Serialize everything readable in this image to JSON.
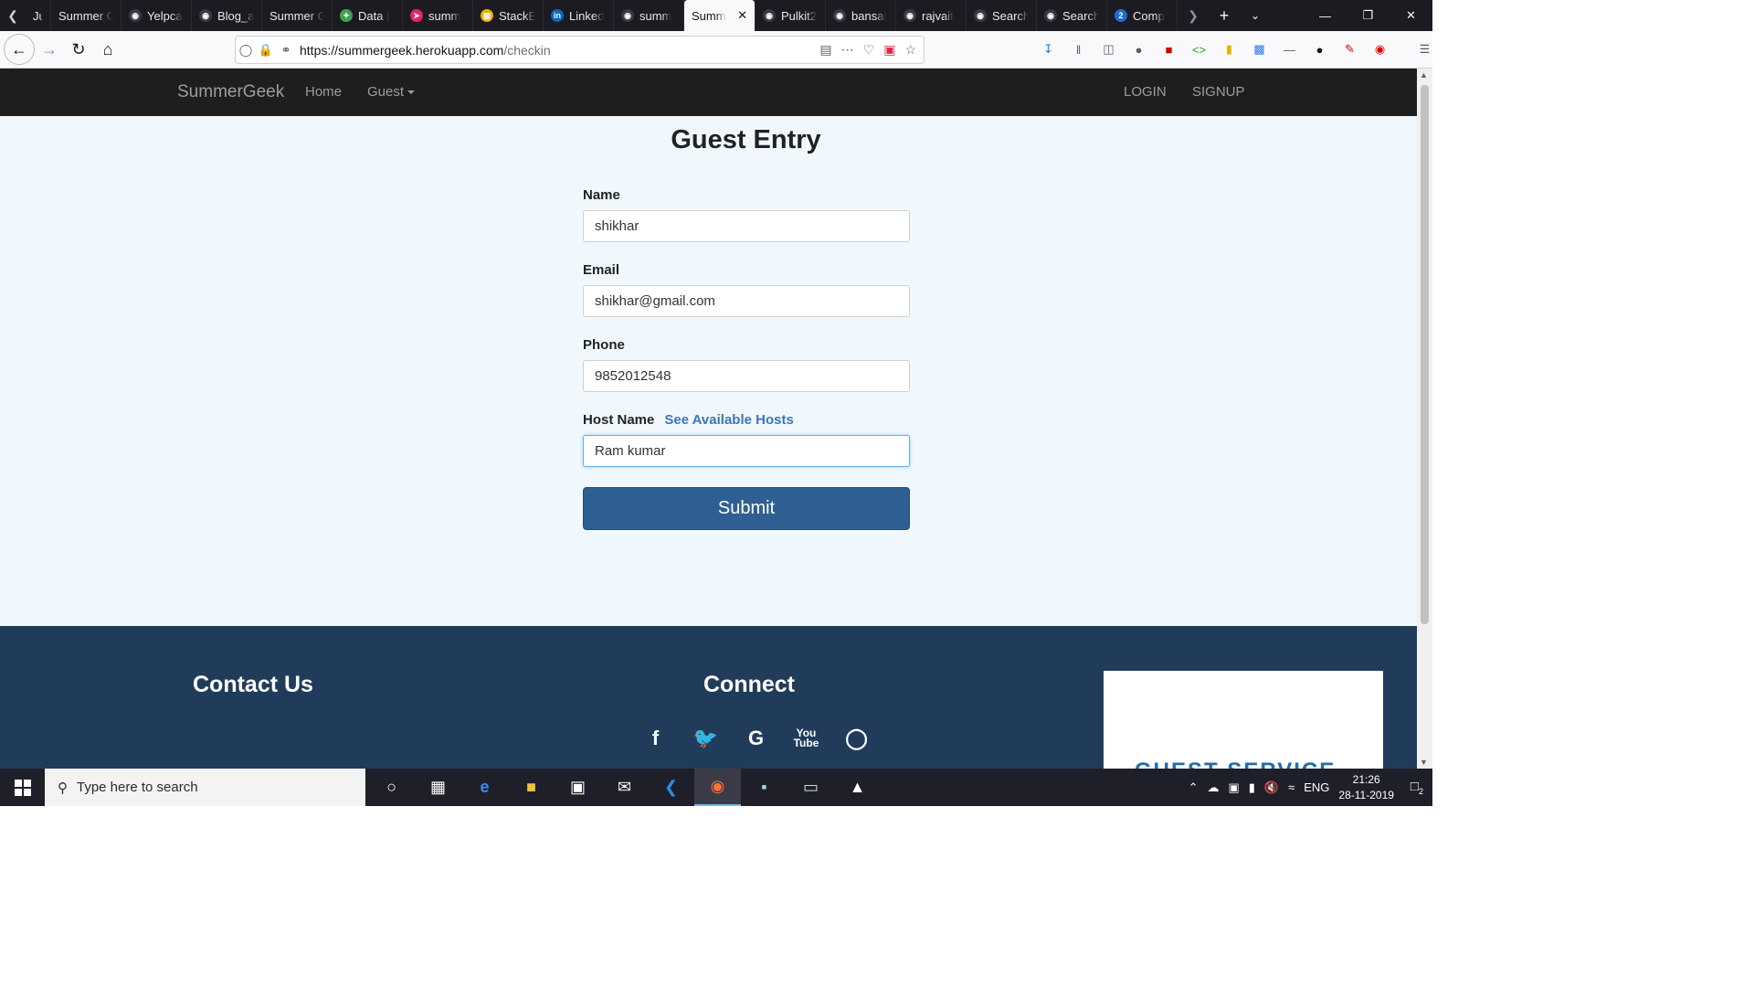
{
  "browser": {
    "tabs": [
      {
        "label": "Jul",
        "icon": ""
      },
      {
        "label": "Summer G",
        "icon": ""
      },
      {
        "label": "Yelpca",
        "icon": "github"
      },
      {
        "label": "Blog_a",
        "icon": "github"
      },
      {
        "label": "Summer G",
        "icon": ""
      },
      {
        "label": "Data |",
        "icon": "leaf"
      },
      {
        "label": "summ",
        "icon": "feather"
      },
      {
        "label": "StackE",
        "icon": "stack"
      },
      {
        "label": "Linked",
        "icon": "in"
      },
      {
        "label": "summ",
        "icon": "github"
      },
      {
        "label": "Summ",
        "icon": "",
        "active": true
      },
      {
        "label": "Pulkit2",
        "icon": "github"
      },
      {
        "label": "bansal",
        "icon": "github"
      },
      {
        "label": "rajvait",
        "icon": "github"
      },
      {
        "label": "Search",
        "icon": "github"
      },
      {
        "label": "Search",
        "icon": "github"
      },
      {
        "label": "Comp",
        "icon": "2"
      }
    ],
    "url_host": "https://summergeek.herokuapp.com",
    "url_path": "/checkin"
  },
  "site": {
    "brand": "SummerGeek",
    "nav_home": "Home",
    "nav_guest": "Guest",
    "nav_login": "LOGIN",
    "nav_signup": "SIGNUP"
  },
  "form": {
    "title": "Guest Entry",
    "name_label": "Name",
    "name_value": "shikhar",
    "email_label": "Email",
    "email_value": "shikhar@gmail.com",
    "phone_label": "Phone",
    "phone_value": "9852012548",
    "host_label": "Host Name",
    "host_link": "See Available Hosts",
    "host_value": "Ram kumar",
    "submit_label": "Submit"
  },
  "footer": {
    "contact_heading": "Contact Us",
    "connect_heading": "Connect",
    "social_icons": [
      "facebook-icon",
      "twitter-icon",
      "google-icon",
      "youtube-icon",
      "instagram-icon"
    ],
    "box_text": "GUEST SERVICE TEAM"
  },
  "taskbar": {
    "search_placeholder": "Type here to search",
    "lang": "ENG",
    "time": "21:26",
    "date": "28-11-2019",
    "notifications": "2"
  }
}
